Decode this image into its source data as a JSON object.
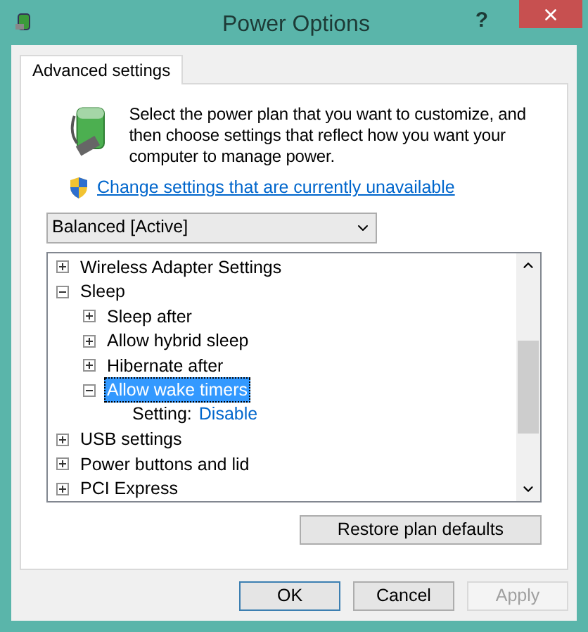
{
  "window": {
    "title": "Power Options",
    "help": "?"
  },
  "tabs": [
    {
      "label": "Advanced settings",
      "selected": true
    }
  ],
  "intro": "Select the power plan that you want to customize, and then choose settings that reflect how you want your computer to manage power.",
  "admin_link": "Change settings that are currently unavailable",
  "plan_select": {
    "value": "Balanced [Active]"
  },
  "tree": [
    {
      "kind": "group",
      "label": "Wireless Adapter Settings",
      "expanded": false,
      "selected": false
    },
    {
      "kind": "group",
      "label": "Sleep",
      "expanded": true,
      "selected": false,
      "children": [
        {
          "kind": "group",
          "label": "Sleep after",
          "expanded": false,
          "selected": false
        },
        {
          "kind": "group",
          "label": "Allow hybrid sleep",
          "expanded": false,
          "selected": false
        },
        {
          "kind": "group",
          "label": "Hibernate after",
          "expanded": false,
          "selected": false
        },
        {
          "kind": "group",
          "label": "Allow wake timers",
          "expanded": true,
          "selected": true,
          "children": [
            {
              "kind": "setting",
              "label": "Setting:",
              "value": "Disable",
              "selected": false
            }
          ]
        }
      ]
    },
    {
      "kind": "group",
      "label": "USB settings",
      "expanded": false,
      "selected": false
    },
    {
      "kind": "group",
      "label": "Power buttons and lid",
      "expanded": false,
      "selected": false
    },
    {
      "kind": "group",
      "label": "PCI Express",
      "expanded": false,
      "selected": false
    }
  ],
  "restore_button": "Restore plan defaults",
  "buttons": [
    {
      "label": "OK",
      "disabled": false,
      "default": true
    },
    {
      "label": "Cancel",
      "disabled": false,
      "default": false
    },
    {
      "label": "Apply",
      "disabled": true,
      "default": false
    }
  ]
}
